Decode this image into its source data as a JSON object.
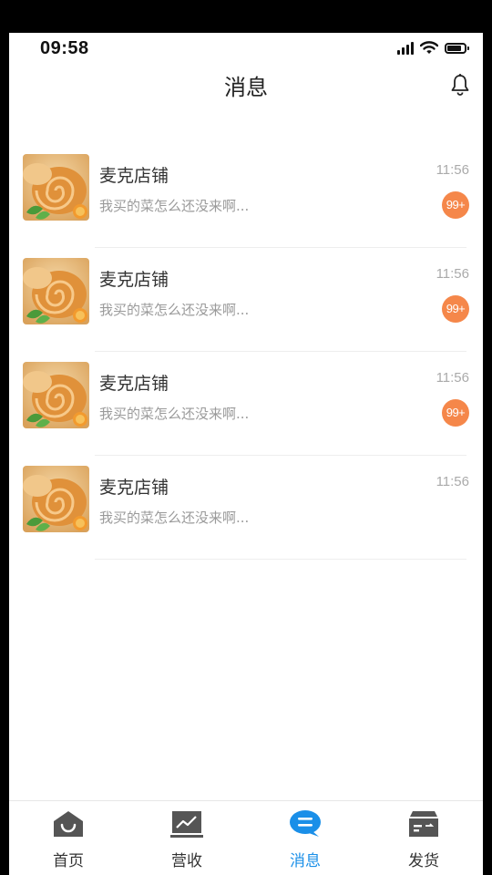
{
  "status_bar": {
    "time": "09:58"
  },
  "header": {
    "title": "消息"
  },
  "messages": [
    {
      "name": "麦克店铺",
      "preview": "我买的菜怎么还没来啊...",
      "time": "11:56",
      "badge": "99+"
    },
    {
      "name": "麦克店铺",
      "preview": "我买的菜怎么还没来啊...",
      "time": "11:56",
      "badge": "99+"
    },
    {
      "name": "麦克店铺",
      "preview": "我买的菜怎么还没来啊...",
      "time": "11:56",
      "badge": "99+"
    },
    {
      "name": "麦克店铺",
      "preview": "我买的菜怎么还没来啊...",
      "time": "11:56"
    }
  ],
  "tabbar": {
    "tabs": [
      {
        "label": "首页",
        "icon": "home-icon"
      },
      {
        "label": "营收",
        "icon": "chart-icon"
      },
      {
        "label": "消息",
        "icon": "message-icon",
        "active": true
      },
      {
        "label": "发货",
        "icon": "shipping-icon"
      }
    ]
  },
  "colors": {
    "accent": "#1a8fe8",
    "badge": "#f5874a"
  }
}
